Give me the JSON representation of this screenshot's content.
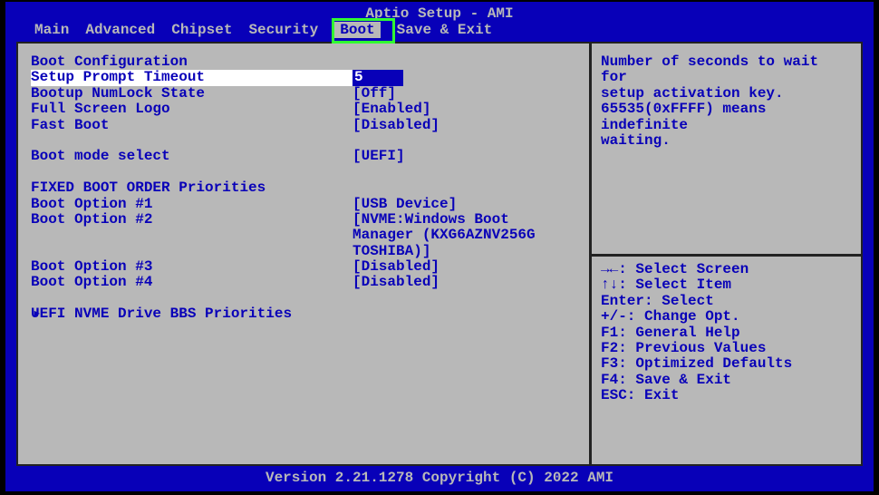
{
  "title": "Aptio Setup - AMI",
  "menu": {
    "items": [
      "Main",
      "Advanced",
      "Chipset",
      "Security",
      "Boot",
      "Save & Exit"
    ],
    "active_index": 4
  },
  "section_header": "Boot Configuration",
  "items": [
    {
      "label": "Setup Prompt Timeout",
      "value": "5",
      "selected": true
    },
    {
      "label": "Bootup NumLock State",
      "value": "[Off]"
    },
    {
      "label": "Full Screen Logo",
      "value": "[Enabled]"
    },
    {
      "label": "Fast Boot",
      "value": "[Disabled]"
    }
  ],
  "boot_mode": {
    "label": "Boot mode select",
    "value": "[UEFI]"
  },
  "fixed_order_header": "FIXED BOOT ORDER Priorities",
  "boot_options": [
    {
      "label": "Boot Option #1",
      "value": "[USB Device]"
    },
    {
      "label": "Boot Option #2",
      "value_lines": [
        "[NVME:Windows Boot",
        "Manager (KXG6AZNV256G",
        "TOSHIBA)]"
      ]
    },
    {
      "label": "Boot Option #3",
      "value": "[Disabled]"
    },
    {
      "label": "Boot Option #4",
      "value": "[Disabled]"
    }
  ],
  "submenu": {
    "arrow": "▸",
    "label": "UEFI NVME Drive BBS Priorities"
  },
  "help": {
    "lines": [
      "Number of seconds to wait for",
      "setup activation key.",
      "65535(0xFFFF) means indefinite",
      "waiting."
    ]
  },
  "keys": [
    "→←: Select Screen",
    "↑↓: Select Item",
    "Enter: Select",
    "+/-: Change Opt.",
    "F1: General Help",
    "F2: Previous Values",
    "F3: Optimized Defaults",
    "F4: Save & Exit",
    "ESC: Exit"
  ],
  "footer": "Version 2.21.1278 Copyright (C) 2022 AMI"
}
